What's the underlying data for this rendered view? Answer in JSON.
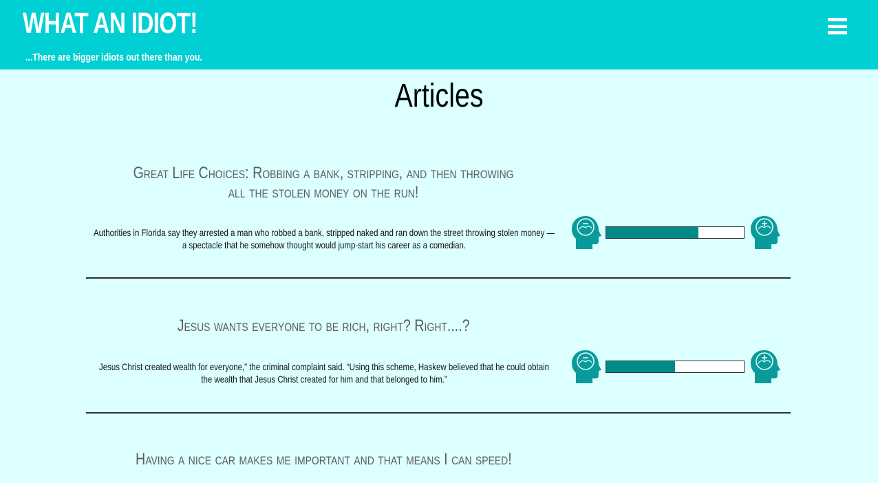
{
  "header": {
    "title": "WHAT AN IDIOT!",
    "tagline": "...There are bigger idiots out there than you."
  },
  "main": {
    "heading": "Articles",
    "articles": [
      {
        "title": "Great Life Choices: Robbing a bank, stripping, and then throwing all the stolen money on the run!",
        "summary": "Authorities in Florida say they arrested a man who robbed a bank, stripped naked and ran down the street throwing stolen money — a spectacle that he somehow thought would jump-start his career as a comedian.",
        "idiot_meter": 0.67
      },
      {
        "title": "Jesus wants everyone to be rich, right? Right....?",
        "summary": "Jesus Christ created wealth for everyone,” the criminal complaint said. “Using this scheme, Haskew believed that he could obtain the wealth that Jesus Christ created for him and that belonged to him.”",
        "idiot_meter": 0.5
      },
      {
        "title": "Having a nice car makes me important and that means I can speed!"
      }
    ]
  },
  "colors": {
    "header_bg": "#00cfd3",
    "page_bg": "#dcffff",
    "meter_fill": "#008b8b",
    "icon_teal": "#0a9a9a"
  },
  "icons": {
    "menu": "hamburger-menu-icon",
    "meter_low": "brain-minus-icon",
    "meter_high": "brain-plus-icon"
  }
}
